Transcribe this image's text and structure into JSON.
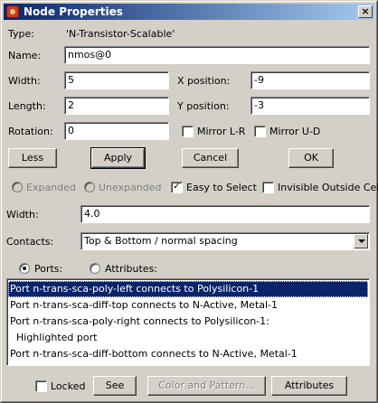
{
  "window": {
    "title": "Node Properties",
    "close_glyph": "×"
  },
  "type_row": {
    "label": "Type:",
    "value": "'N-Transistor-Scalable'"
  },
  "name": {
    "label": "Name:",
    "value": "nmos@0"
  },
  "width": {
    "label": "Width:",
    "value": "5"
  },
  "xpos": {
    "label": "X position:",
    "value": "-9"
  },
  "length": {
    "label": "Length:",
    "value": "2"
  },
  "ypos": {
    "label": "Y position:",
    "value": "-3"
  },
  "rotation": {
    "label": "Rotation:",
    "value": "0"
  },
  "mirror_lr": {
    "label": "Mirror L-R",
    "checked": false
  },
  "mirror_ud": {
    "label": "Mirror U-D",
    "checked": false
  },
  "buttons": {
    "less": "Less",
    "apply": "Apply",
    "cancel": "Cancel",
    "ok": "OK"
  },
  "expanded": {
    "label": "Expanded",
    "enabled": false
  },
  "unexpanded": {
    "label": "Unexpanded",
    "enabled": false
  },
  "easy_select": {
    "label": "Easy to Select",
    "checked": true,
    "check_glyph": "✓"
  },
  "invisible_outside": {
    "label": "Invisible Outside Cell",
    "checked": false
  },
  "width2": {
    "label": "Width:",
    "value": "4.0"
  },
  "contacts": {
    "label": "Contacts:",
    "selected": "Top & Bottom / normal spacing"
  },
  "view": {
    "ports_label": "Ports:",
    "ports_selected": true,
    "attributes_label": "Attributes:"
  },
  "ports_list": [
    {
      "text": "Port n-trans-sca-poly-left connects to Polysilicon-1",
      "selected": true
    },
    {
      "text": "Port n-trans-sca-diff-top connects to N-Active, Metal-1",
      "selected": false
    },
    {
      "text": "Port n-trans-sca-poly-right connects to Polysilicon-1:",
      "selected": false
    },
    {
      "text": "  Highlighted port",
      "selected": false
    },
    {
      "text": "Port n-trans-sca-diff-bottom connects to N-Active, Metal-1",
      "selected": false
    }
  ],
  "bottom": {
    "locked": "Locked",
    "see": "See",
    "color_pattern": "Color and Pattern...",
    "attributes": "Attributes"
  },
  "colors": {
    "titlebar": "#0a246a",
    "face": "#d4d0c8",
    "selection": "#0a246a"
  },
  "icons": {
    "app": "app-icon",
    "close": "close-icon"
  }
}
